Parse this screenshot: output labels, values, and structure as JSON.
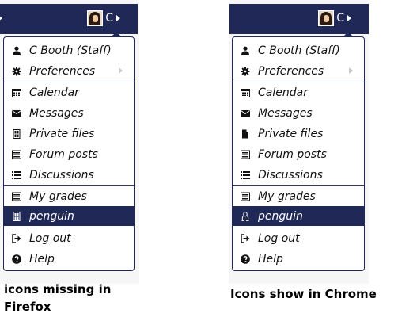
{
  "firefox": {
    "user_initial": "C",
    "menu": [
      {
        "label": "C Booth (Staff)",
        "icon": "user-icon"
      },
      {
        "label": "Preferences",
        "icon": "gear-icon",
        "submenu": true
      },
      {
        "label": "Calendar",
        "icon": "calendar-icon"
      },
      {
        "label": "Messages",
        "icon": "envelope-icon"
      },
      {
        "label": "Private files",
        "icon": "missing-glyph-icon"
      },
      {
        "label": "Forum posts",
        "icon": "list-alt-icon"
      },
      {
        "label": "Discussions",
        "icon": "list-icon"
      },
      {
        "label": "My grades",
        "icon": "list-alt-icon"
      },
      {
        "label": "penguin",
        "icon": "missing-glyph-icon",
        "active": true
      },
      {
        "label": "Log out",
        "icon": "sign-out-icon"
      },
      {
        "label": "Help",
        "icon": "question-circle-icon"
      }
    ],
    "caption_line1": "icons missing in",
    "caption_line2": "Firefox"
  },
  "chrome": {
    "user_initial": "C",
    "menu": [
      {
        "label": "C Booth (Staff)",
        "icon": "user-icon"
      },
      {
        "label": "Preferences",
        "icon": "gear-icon",
        "submenu": true
      },
      {
        "label": "Calendar",
        "icon": "calendar-icon"
      },
      {
        "label": "Messages",
        "icon": "envelope-icon"
      },
      {
        "label": "Private files",
        "icon": "file-icon"
      },
      {
        "label": "Forum posts",
        "icon": "list-alt-icon"
      },
      {
        "label": "Discussions",
        "icon": "list-icon"
      },
      {
        "label": "My grades",
        "icon": "list-alt-icon"
      },
      {
        "label": "penguin",
        "icon": "linux-penguin-icon",
        "active": true
      },
      {
        "label": "Log out",
        "icon": "sign-out-icon"
      },
      {
        "label": "Help",
        "icon": "question-circle-icon"
      }
    ],
    "caption": "Icons show in Chrome"
  },
  "colors": {
    "navbar": "#1f2856",
    "active_item": "#1f2856",
    "menu_border": "#1f2856"
  }
}
